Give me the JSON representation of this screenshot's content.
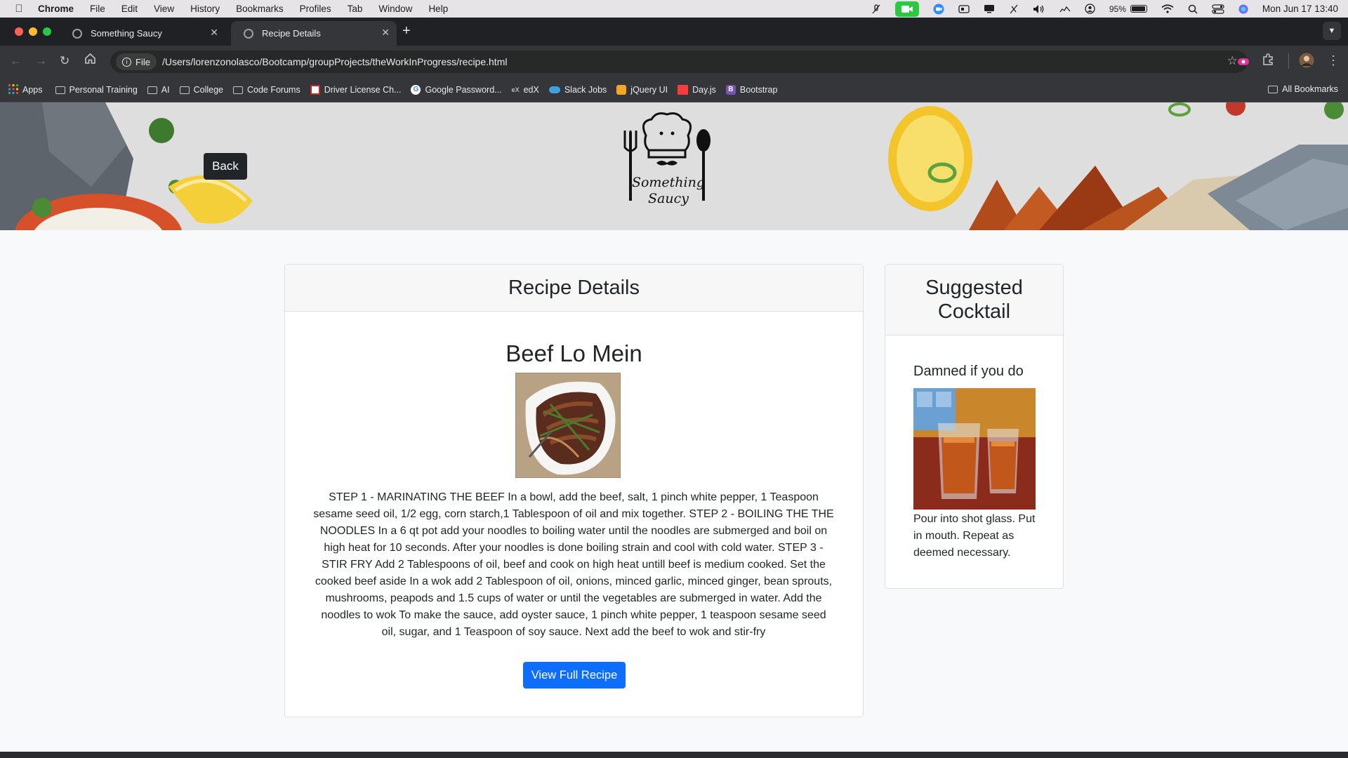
{
  "menubar": {
    "app_name": "Chrome",
    "items": [
      "File",
      "Edit",
      "View",
      "History",
      "Bookmarks",
      "Profiles",
      "Tab",
      "Window",
      "Help"
    ],
    "battery": "95%",
    "datetime": "Mon Jun 17  13:40"
  },
  "tabs": [
    {
      "title": "Something Saucy"
    },
    {
      "title": "Recipe Details"
    }
  ],
  "address_bar": {
    "scheme_chip": "File",
    "url": "/Users/lorenzonolasco/Bootcamp/groupProjects/theWorkInProgress/recipe.html"
  },
  "bookmarks": {
    "items": [
      {
        "label": "Apps",
        "icon": "apps-grid-icon"
      },
      {
        "label": "Personal Training",
        "icon": "folder-icon"
      },
      {
        "label": "AI",
        "icon": "folder-icon"
      },
      {
        "label": "College",
        "icon": "folder-icon"
      },
      {
        "label": "Code Forums",
        "icon": "folder-icon"
      },
      {
        "label": "Driver License Ch...",
        "icon": "dmv-favicon"
      },
      {
        "label": "Google Password...",
        "icon": "google-favicon"
      },
      {
        "label": "edX",
        "icon": "edx-favicon"
      },
      {
        "label": "Slack Jobs",
        "icon": "slack-favicon"
      },
      {
        "label": "jQuery UI",
        "icon": "jquery-favicon"
      },
      {
        "label": "Day.js",
        "icon": "dayjs-favicon"
      },
      {
        "label": "Bootstrap",
        "icon": "bootstrap-favicon"
      }
    ],
    "all_bookmarks": "All Bookmarks"
  },
  "header": {
    "back_label": "Back",
    "logo_text_line1": "Something",
    "logo_text_line2": "Saucy"
  },
  "recipe": {
    "card_title": "Recipe Details",
    "name": "Beef Lo Mein",
    "instructions": "STEP 1 - MARINATING THE BEEF In a bowl, add the beef, salt, 1 pinch white pepper, 1 Teaspoon sesame seed oil, 1/2 egg, corn starch,1 Tablespoon of oil and mix together. STEP 2 - BOILING THE THE NOODLES In a 6 qt pot add your noodles to boiling water until the noodles are submerged and boil on high heat for 10 seconds. After your noodles is done boiling strain and cool with cold water. STEP 3 - STIR FRY Add 2 Tablespoons of oil, beef and cook on high heat untill beef is medium cooked. Set the cooked beef aside In a wok add 2 Tablespoon of oil, onions, minced garlic, minced ginger, bean sprouts, mushrooms, peapods and 1.5 cups of water or until the vegetables are submerged in water. Add the noodles to wok To make the sauce, add oyster sauce, 1 pinch white pepper, 1 teaspoon sesame seed oil, sugar, and 1 Teaspoon of soy sauce. Next add the beef to wok and stir-fry",
    "button_label": "View Full Recipe"
  },
  "cocktail": {
    "card_title_line1": "Suggested",
    "card_title_line2": "Cocktail",
    "name": "Damned if you do",
    "instructions": "Pour into shot glass. Put in mouth. Repeat as deemed necessary."
  },
  "colors": {
    "primary_button": "#0d6efd",
    "back_button": "#212529",
    "page_background": "#f8f9fa",
    "chrome_dark": "#202124",
    "facetime_green": "#2bc840"
  }
}
